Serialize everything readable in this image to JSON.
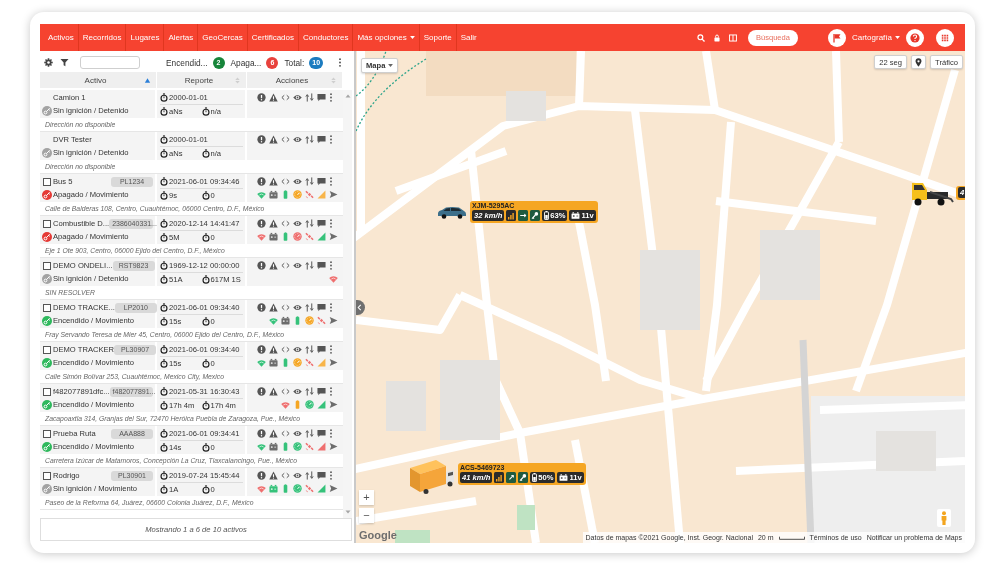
{
  "navbar": {
    "links": [
      {
        "label": "Activos",
        "kind": "link"
      },
      {
        "label": "Recorridos",
        "kind": "link"
      },
      {
        "label": "Lugares",
        "kind": "link"
      },
      {
        "label": "Alertas",
        "kind": "link"
      },
      {
        "label": "GeoCercas",
        "kind": "link"
      },
      {
        "label": "Certificados",
        "kind": "link"
      },
      {
        "label": "Conductores",
        "kind": "link"
      },
      {
        "label": "Más opciones",
        "kind": "dropdown"
      },
      {
        "label": "Soporte",
        "kind": "link"
      },
      {
        "label": "Salir",
        "kind": "link"
      }
    ],
    "search": {
      "placeholder": "Búsqueda"
    },
    "map_type": {
      "label": "Cartografía"
    }
  },
  "panel": {
    "counters": [
      {
        "label": "Encendid...",
        "count": "2",
        "color": "#17853a"
      },
      {
        "label": "Apaga...",
        "count": "6",
        "color": "#e8413c"
      },
      {
        "label": "Total:",
        "count": "10",
        "color": "#1c7cc0"
      }
    ],
    "table": {
      "columns": [
        {
          "label": "Activo",
          "sorted": true
        },
        {
          "label": "Reporte",
          "sorted": false
        },
        {
          "label": "Acciones",
          "sorted": false
        }
      ],
      "rows": [
        {
          "kind": "plain",
          "name": "Camion 1",
          "status": {
            "text": "Sin ignición / Detenido",
            "color": "#a3a3a3"
          },
          "report": "2000-01-01",
          "time_1": "aNs",
          "time_2": "n/a",
          "address": "Dirección no disponible"
        },
        {
          "kind": "plain",
          "name": "DVR Tester",
          "status": {
            "text": "Sin ignición / Detenido",
            "color": "#a3a3a3"
          },
          "report": "2000-01-01",
          "time_1": "aNs",
          "time_2": "n/a",
          "address": "Dirección no disponible"
        },
        {
          "kind": "checkable",
          "checked": false,
          "name": "Bus 5",
          "plate": "PL1234",
          "status": {
            "text": "Apagado / Movimiento",
            "color": "#e53935"
          },
          "report": "2021-06-01 09:34:46",
          "time_1": "9s",
          "time_2": "0",
          "indicators": [
            {
              "kind": "wifi",
              "color": "#35c27a"
            },
            {
              "kind": "car_battery",
              "color": "#6c6c6c"
            },
            {
              "kind": "battery",
              "color": "#35c27a"
            },
            {
              "kind": "gauge",
              "color": "#f5a623"
            },
            {
              "kind": "satellite",
              "color": "#ef6f6f"
            },
            {
              "kind": "signal",
              "color": "#f8b54a"
            },
            {
              "kind": "send",
              "color": "#6c6c6c"
            }
          ],
          "address": "Calle de Balderas 108, Centro, Cuauhtémoc, 06000 Centro, D.F., México"
        },
        {
          "kind": "checkable",
          "checked": false,
          "name": "Combustible D...",
          "plate": "2386040331...",
          "status": {
            "text": "Apagado / Movimiento",
            "color": "#e53935"
          },
          "report": "2020-12-14 14:41:47",
          "time_1": "5M",
          "time_2": "0",
          "indicators": [
            {
              "kind": "wifi",
              "color": "#ef6f6f"
            },
            {
              "kind": "car_battery",
              "color": "#6c6c6c"
            },
            {
              "kind": "battery",
              "color": "#35c27a"
            },
            {
              "kind": "gauge",
              "color": "#ef6f6f"
            },
            {
              "kind": "satellite",
              "color": "#ef6f6f"
            },
            {
              "kind": "signal",
              "color": "#35c27a"
            },
            {
              "kind": "send",
              "color": "#6c6c6c"
            }
          ],
          "address": "Eje 1 Ote 903, Centro, 06000 Ejido del Centro, D.F., México"
        },
        {
          "kind": "checkable",
          "checked": false,
          "name": "DEMO ONDELI...",
          "plate": "RST9823",
          "status": {
            "text": "Sin ignición / Detenido",
            "color": "#a3a3a3"
          },
          "report": "1969-12-12 00:00:00",
          "time_1": "51A",
          "time_2": "617M 1S",
          "indicators": [
            {
              "kind": "wifi",
              "color": "#ef6f6f"
            }
          ],
          "address": "SIN RESOLVER"
        },
        {
          "kind": "checkable",
          "checked": false,
          "name": "DEMO TRACKE...",
          "plate": "LP2010",
          "status": {
            "text": "Encendido / Movimiento",
            "color": "#2eb85c"
          },
          "report": "2021-06-01 09:34:40",
          "time_1": "15s",
          "time_2": "0",
          "indicators": [
            {
              "kind": "wifi",
              "color": "#35c27a"
            },
            {
              "kind": "car_battery",
              "color": "#6c6c6c"
            },
            {
              "kind": "battery",
              "color": "#35c27a"
            },
            {
              "kind": "gauge",
              "color": "#f5a623"
            },
            {
              "kind": "satellite",
              "color": "#ef6f6f"
            },
            {
              "kind": "send",
              "color": "#6c6c6c"
            }
          ],
          "address": "Fray Servando Teresa de Mier 45, Centro, 06000 Ejido del Centro, D.F., México"
        },
        {
          "kind": "checkable",
          "checked": false,
          "name": "DEMO TRACKER",
          "plate": "PL30907",
          "status": {
            "text": "Encendido / Movimiento",
            "color": "#2eb85c"
          },
          "report": "2021-06-01 09:34:40",
          "time_1": "15s",
          "time_2": "0",
          "indicators": [
            {
              "kind": "wifi",
              "color": "#35c27a"
            },
            {
              "kind": "car_battery",
              "color": "#6c6c6c"
            },
            {
              "kind": "battery",
              "color": "#35c27a"
            },
            {
              "kind": "gauge",
              "color": "#f5a623"
            },
            {
              "kind": "satellite",
              "color": "#ef6f6f"
            },
            {
              "kind": "signal",
              "color": "#f8b54a"
            },
            {
              "kind": "send",
              "color": "#6c6c6c"
            }
          ],
          "address": "Calle Simón Bolívar 253, Cuauhtémoc, Mexico City, Mexico"
        },
        {
          "kind": "checkable",
          "checked": false,
          "name": "f482077891dfc...",
          "plate": "f482077891...",
          "status": {
            "text": "Encendido / Movimiento",
            "color": "#2eb85c"
          },
          "report": "2021-05-31 16:30:43",
          "time_1": "17h 4m",
          "time_2": "17h 4m",
          "indicators": [
            {
              "kind": "wifi",
              "color": "#ef6f6f"
            },
            {
              "kind": "battery",
              "color": "#f5a623"
            },
            {
              "kind": "gauge",
              "color": "#35c27a"
            },
            {
              "kind": "signal",
              "color": "#35c27a"
            },
            {
              "kind": "send",
              "color": "#6c6c6c"
            }
          ],
          "address": "Zacapoaxtla 314, Granjas del Sur, 72470 Heróica Puebla de Zaragoza, Pue., México"
        },
        {
          "kind": "checkable",
          "checked": false,
          "name": "Prueba Ruta",
          "plate": "AAA888",
          "status": {
            "text": "Encendido / Movimiento",
            "color": "#2eb85c"
          },
          "report": "2021-06-01 09:34:41",
          "time_1": "14s",
          "time_2": "0",
          "indicators": [
            {
              "kind": "wifi",
              "color": "#35c27a"
            },
            {
              "kind": "car_battery",
              "color": "#6c6c6c"
            },
            {
              "kind": "battery",
              "color": "#35c27a"
            },
            {
              "kind": "gauge",
              "color": "#35c27a"
            },
            {
              "kind": "satellite",
              "color": "#ef6f6f"
            },
            {
              "kind": "signal",
              "color": "#ef6f6f"
            },
            {
              "kind": "send",
              "color": "#6c6c6c"
            }
          ],
          "address": "Carretera Izúcar de Matamoros, Concepción La Cruz, Tlaxcalancingo, Pue., México"
        },
        {
          "kind": "checkable",
          "checked": false,
          "name": "Rodrigo",
          "plate": "PL30901",
          "status": {
            "text": "Sin ignición / Movimiento",
            "color": "#a3a3a3"
          },
          "report": "2019-07-24 15:45:44",
          "time_1": "1A",
          "time_2": "0",
          "indicators": [
            {
              "kind": "wifi",
              "color": "#ef6f6f"
            },
            {
              "kind": "car_battery",
              "color": "#35c27a"
            },
            {
              "kind": "battery",
              "color": "#35c27a"
            },
            {
              "kind": "gauge",
              "color": "#35c27a"
            },
            {
              "kind": "satellite",
              "color": "#ef6f6f"
            },
            {
              "kind": "signal",
              "color": "#35c27a"
            },
            {
              "kind": "send",
              "color": "#6c6c6c"
            }
          ],
          "address": "Paseo de la Reforma 64, Juárez, 06600 Colonia Juárez, D.F., México"
        }
      ],
      "footer": "Mostrando 1 a 6 de 10 activos"
    }
  },
  "map": {
    "type_control": "Mapa",
    "refresh": "22 seg",
    "traffic": "Tráfico",
    "zoom": [
      "+",
      "−"
    ],
    "vehicles": [
      {
        "kind": "car",
        "plate": "XJM-5295AC",
        "speed": "32 km/h",
        "heading": "→",
        "battery": "63%",
        "voltage": "11v"
      },
      {
        "kind": "truck",
        "speed": "4"
      },
      {
        "kind": "box_truck",
        "plate": "ACS-5469723",
        "speed": "41 km/h",
        "heading": "↗",
        "battery": "50%",
        "voltage": "11v"
      }
    ],
    "attribution": {
      "logo": "Google",
      "data": "Datos de mapas ©2021 Google, Inst. Geogr. Nacional",
      "scale": "20 m",
      "terms": "Términos de uso",
      "report": "Notificar un problema de Maps"
    }
  }
}
